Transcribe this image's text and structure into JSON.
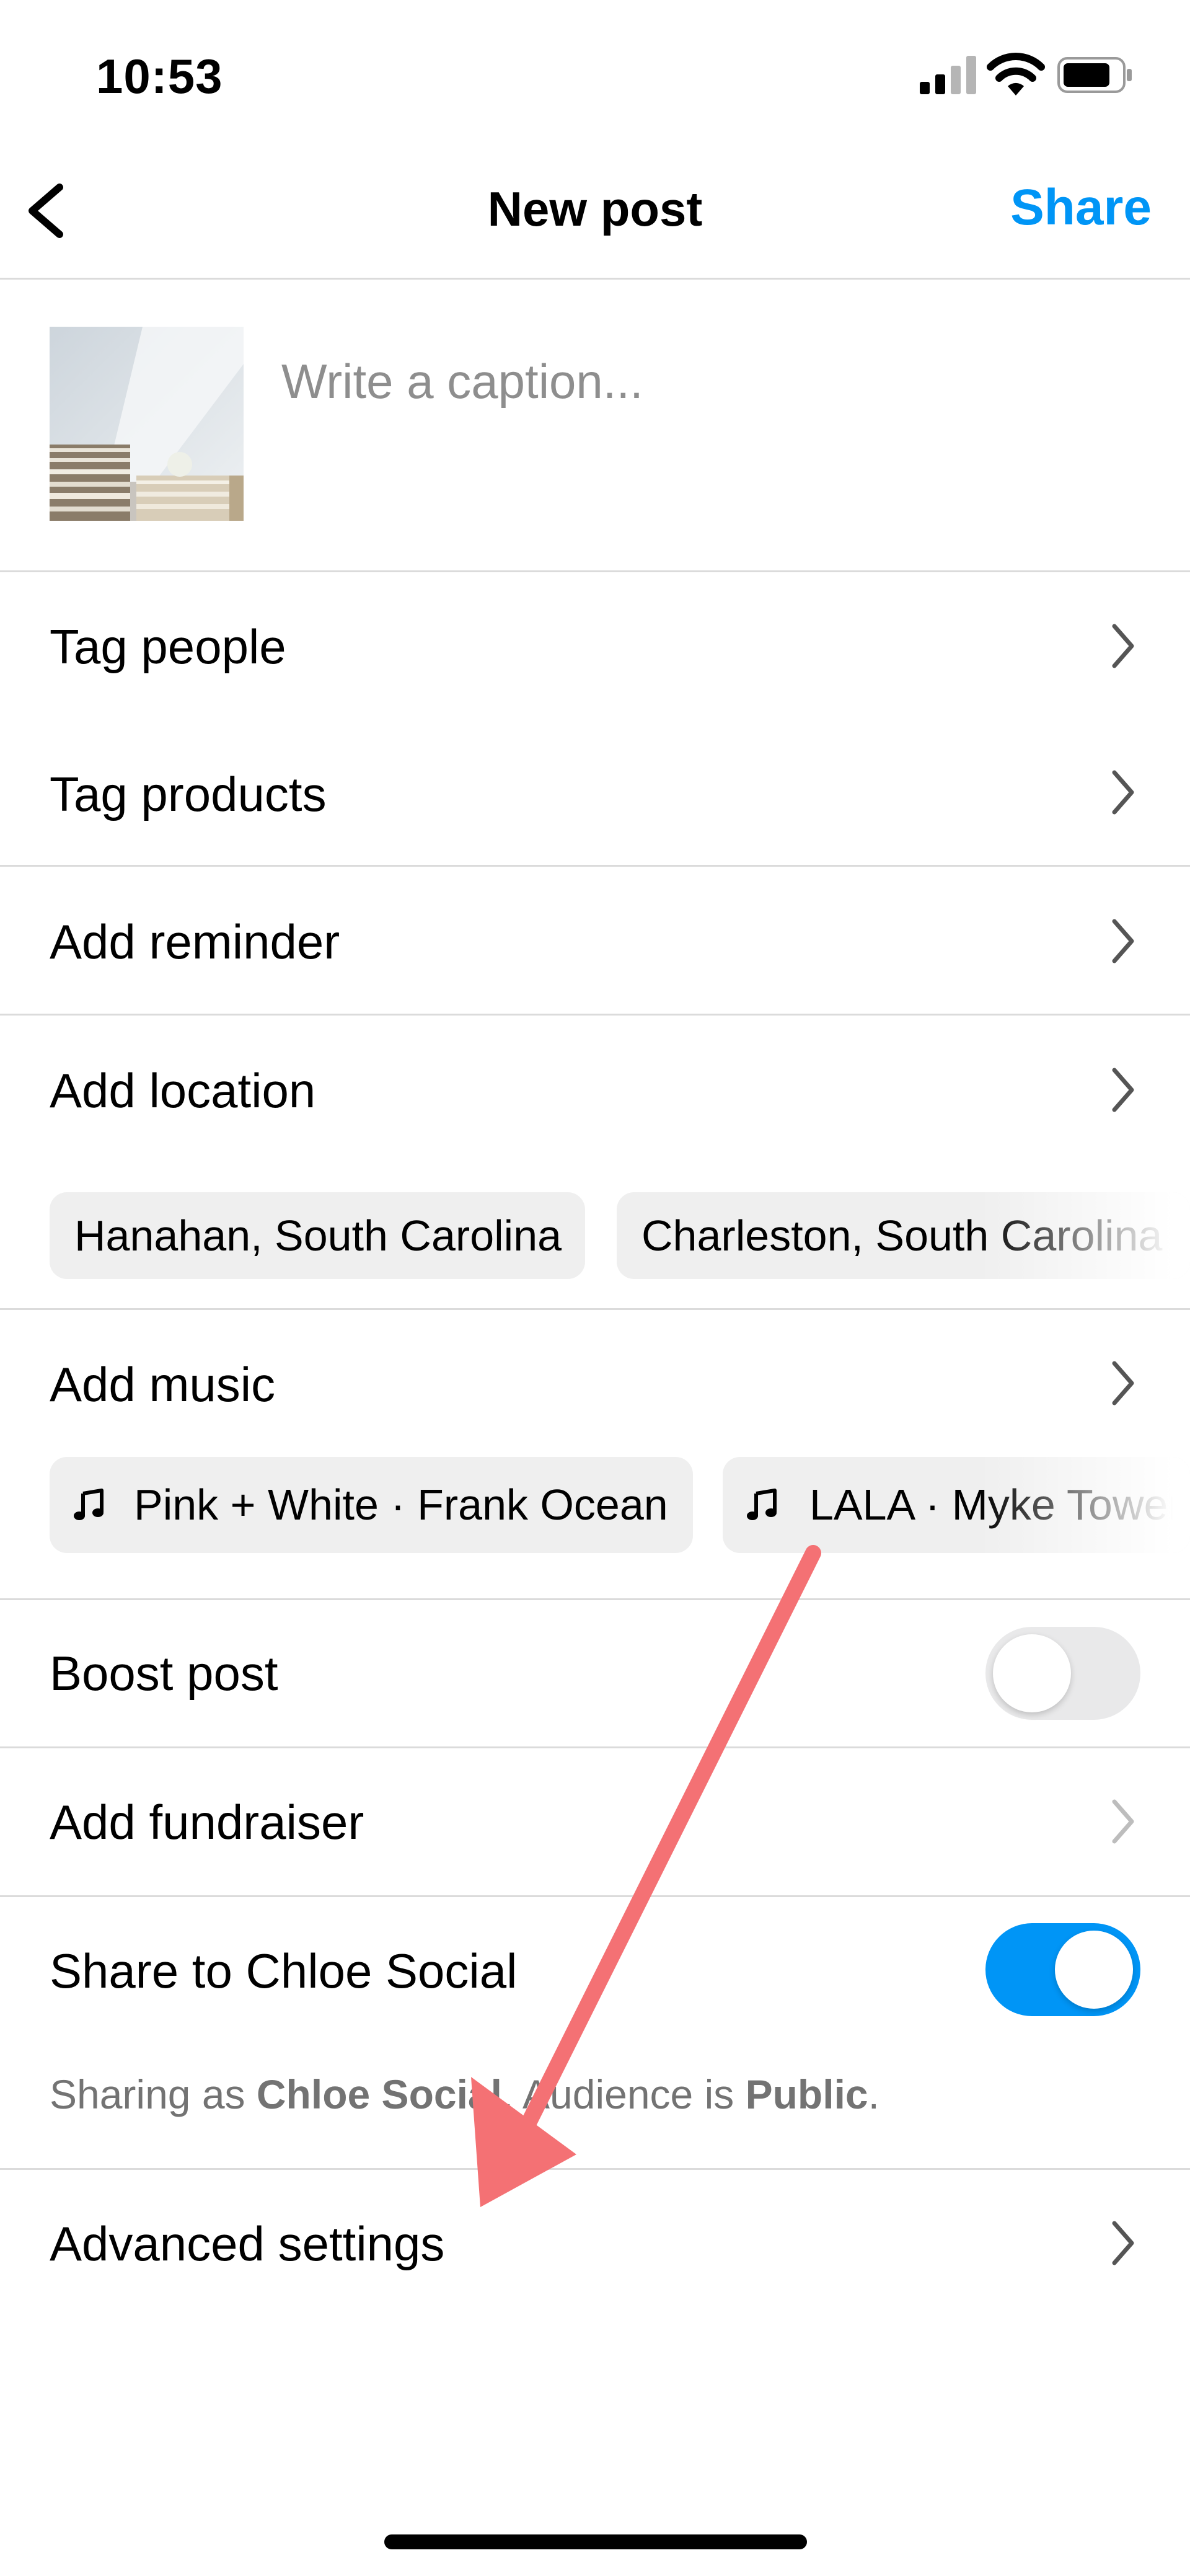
{
  "status_bar": {
    "time": "10:53"
  },
  "nav": {
    "title": "New post",
    "share_label": "Share"
  },
  "caption": {
    "placeholder": "Write a caption..."
  },
  "rows": {
    "tag_people": "Tag people",
    "tag_products": "Tag products",
    "add_reminder": "Add reminder",
    "add_location": "Add location",
    "add_music": "Add music",
    "boost_post": "Boost post",
    "add_fundraiser": "Add fundraiser",
    "share_to": "Share to Chloe Social",
    "advanced_settings": "Advanced settings"
  },
  "location_chips": [
    "Hanahan, South Carolina",
    "Charleston, South Carolina"
  ],
  "music_chips": [
    "Pink + White · Frank Ocean",
    "LALA · Myke Towers"
  ],
  "toggles": {
    "boost_post": false,
    "share_to_chloe_social": true
  },
  "sharing_info": {
    "prefix": "Sharing as ",
    "account": "Chloe Social",
    "middle": ". Audience is ",
    "audience": "Public",
    "suffix": "."
  },
  "colors": {
    "accent": "#0095f6",
    "annotation_arrow": "#f47174"
  },
  "icons": [
    "back-chevron-icon",
    "chevron-right-icon",
    "music-note-icon",
    "signal-icon",
    "wifi-icon",
    "battery-icon"
  ]
}
